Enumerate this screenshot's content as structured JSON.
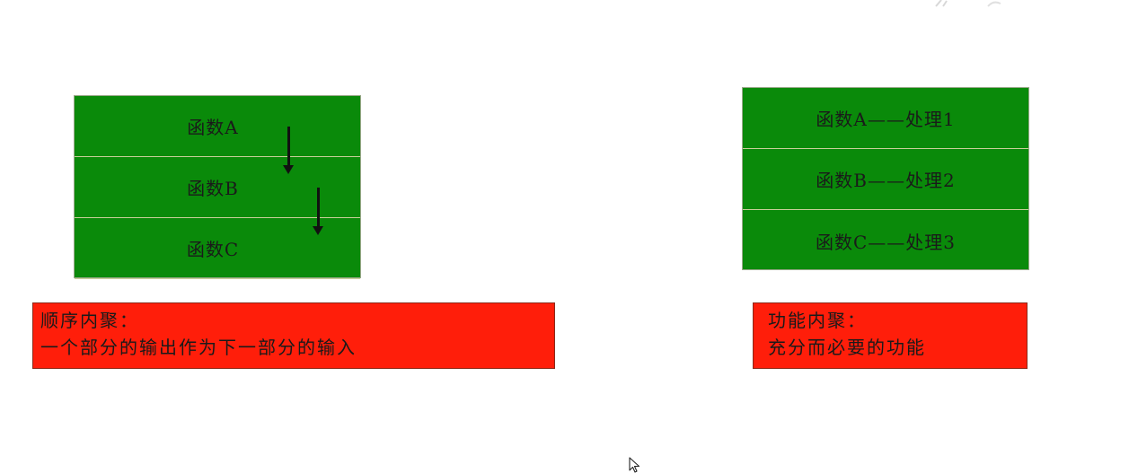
{
  "left_stack": {
    "rows": [
      "函数A",
      "函数B",
      "函数C"
    ]
  },
  "right_stack": {
    "rows": [
      "函数A——处理1",
      "函数B——处理2",
      "函数C——处理3"
    ]
  },
  "left_note": {
    "line1": "顺序内聚：",
    "line2": "一个部分的输出作为下一部分的输入"
  },
  "right_note": {
    "line1": "功能内聚：",
    "line2": "充分而必要的功能"
  },
  "colors": {
    "box_green": "#0a8a0a",
    "note_red": "#ff1e0a"
  },
  "icons": [
    "down-arrow-icon",
    "cursor-icon"
  ]
}
